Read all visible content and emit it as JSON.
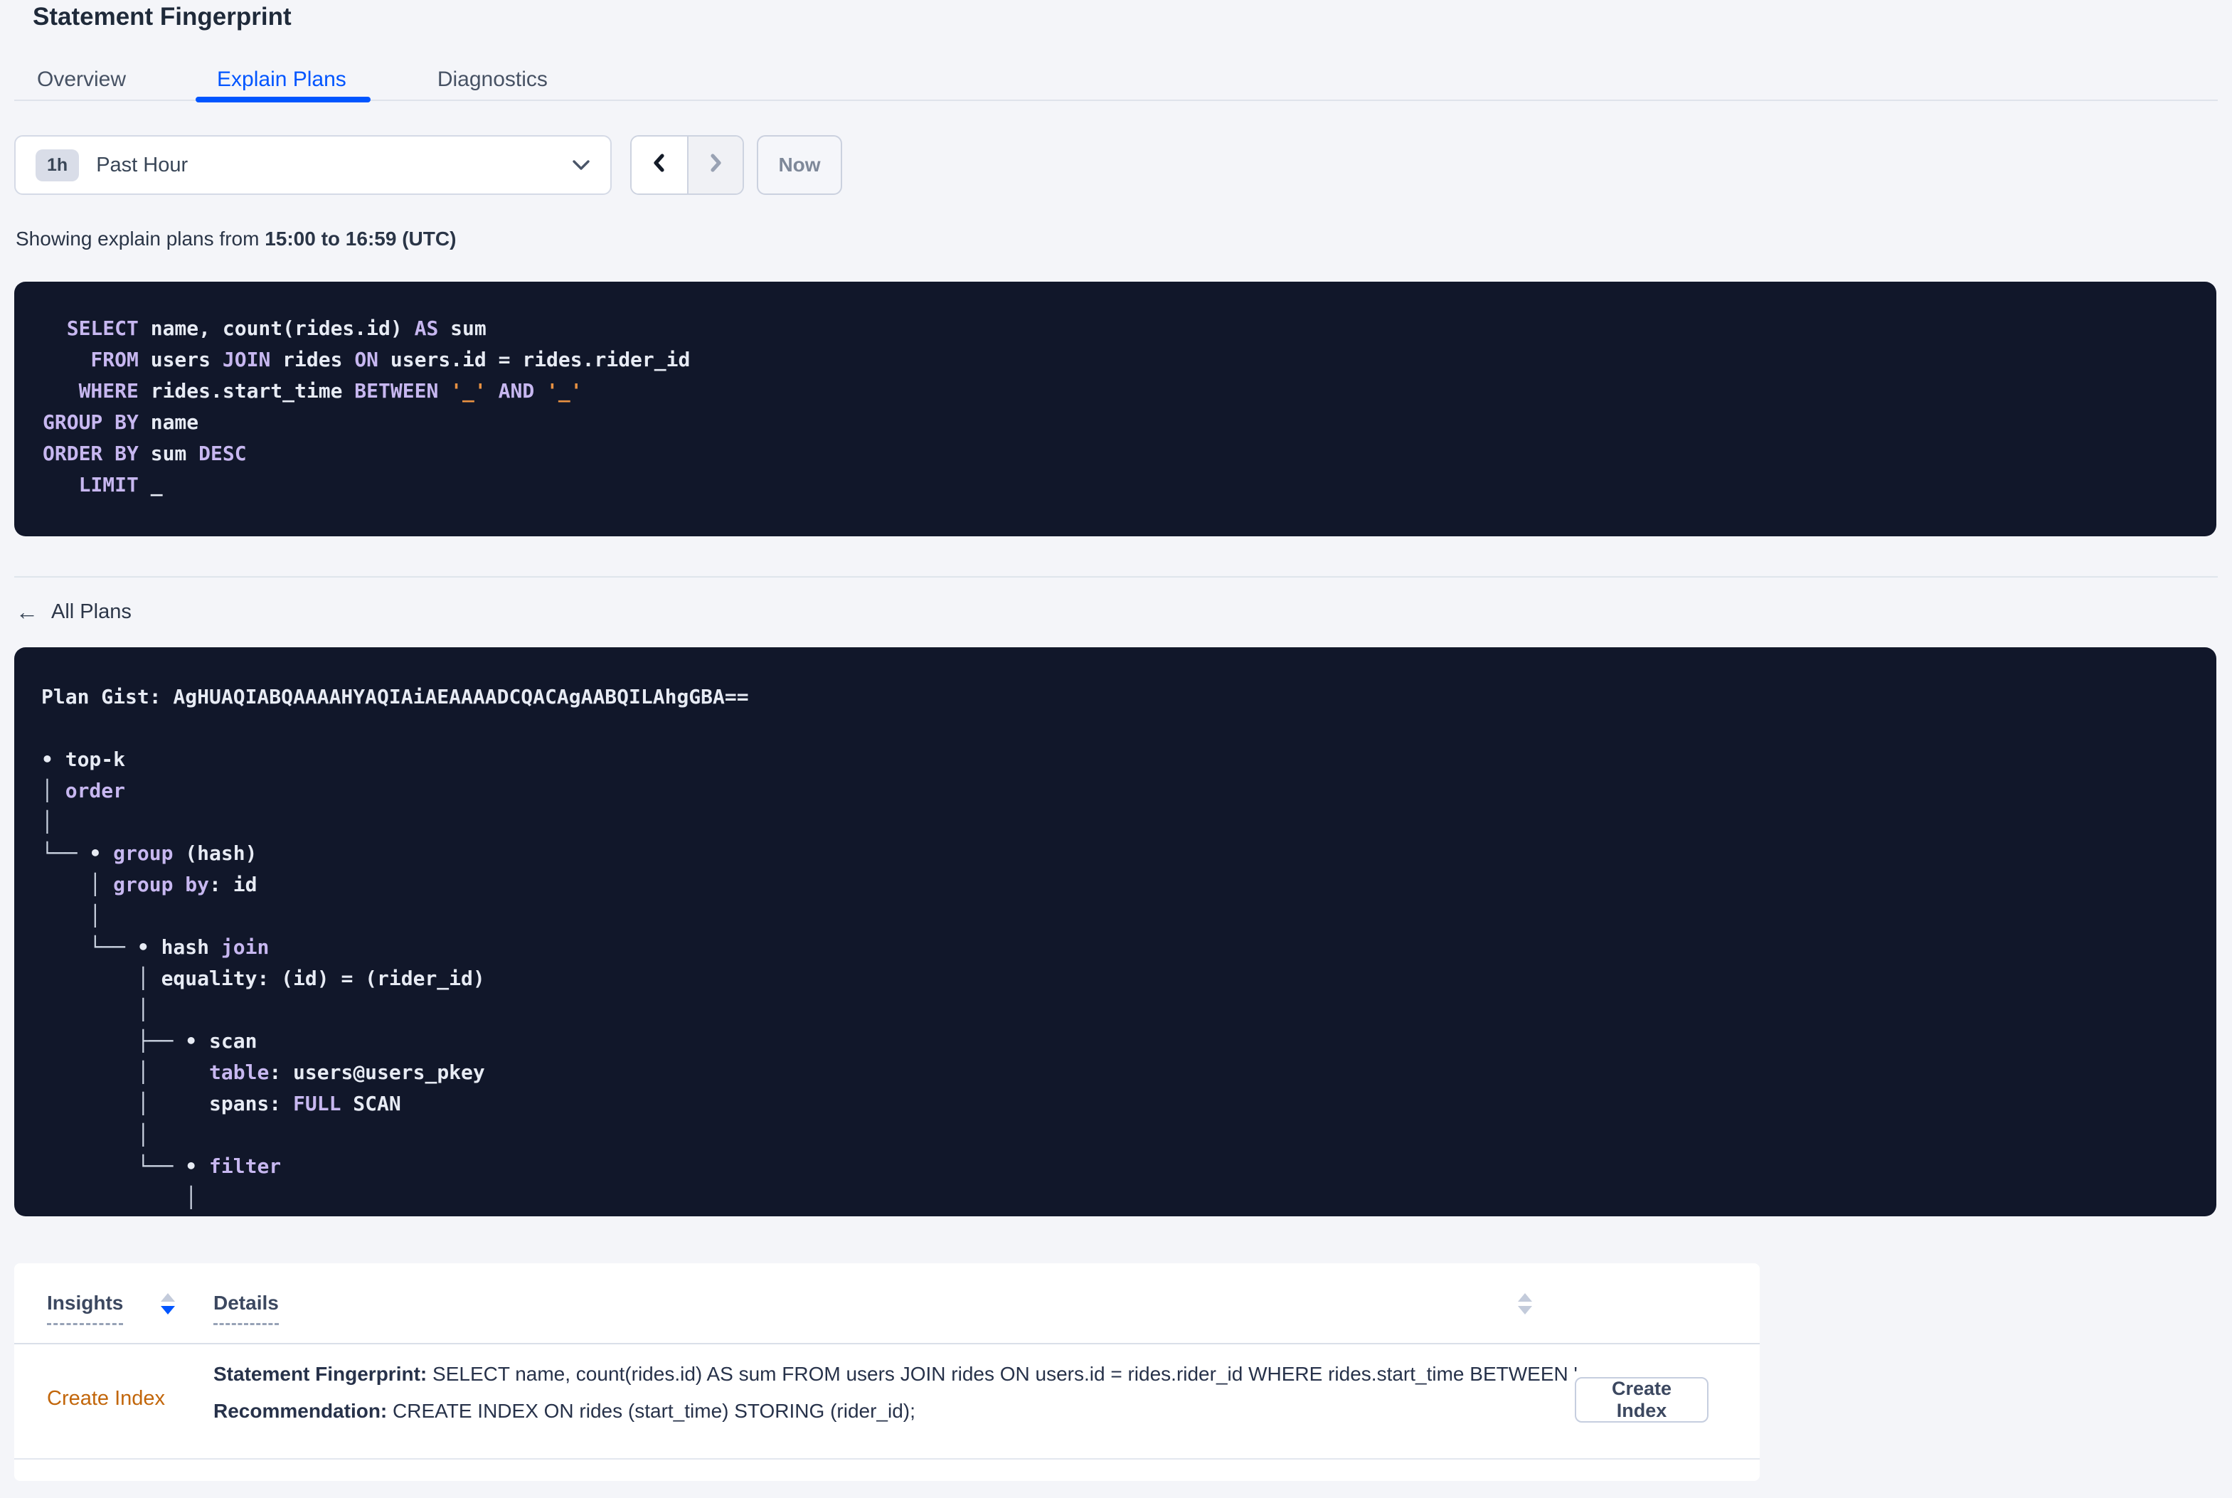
{
  "page": {
    "title": "Statement Fingerprint"
  },
  "tabs": {
    "overview": "Overview",
    "explain_plans": "Explain Plans",
    "diagnostics": "Diagnostics"
  },
  "time_picker": {
    "badge": "1h",
    "selected": "Past Hour",
    "now_button": "Now"
  },
  "caption": {
    "prefix": "Showing explain plans from ",
    "range": "15:00 to 16:59 (UTC)"
  },
  "sql_block": {
    "lines": [
      [
        [
          "p",
          "  SELECT"
        ],
        [
          "w",
          " name, count(rides.id) "
        ],
        [
          "p",
          "AS"
        ],
        [
          "w",
          " sum"
        ]
      ],
      [
        [
          "p",
          "    FROM"
        ],
        [
          "w",
          " users "
        ],
        [
          "p",
          "JOIN"
        ],
        [
          "w",
          " rides "
        ],
        [
          "p",
          "ON"
        ],
        [
          "w",
          " users.id = rides.rider_id"
        ]
      ],
      [
        [
          "p",
          "   WHERE"
        ],
        [
          "w",
          " rides.start_time "
        ],
        [
          "p",
          "BETWEEN"
        ],
        [
          "w",
          " "
        ],
        [
          "o",
          "'_'"
        ],
        [
          "w",
          " "
        ],
        [
          "p",
          "AND"
        ],
        [
          "w",
          " "
        ],
        [
          "o",
          "'_'"
        ]
      ],
      [
        [
          "p",
          "GROUP BY"
        ],
        [
          "w",
          " name"
        ]
      ],
      [
        [
          "p",
          "ORDER BY"
        ],
        [
          "w",
          " sum "
        ],
        [
          "p",
          "DESC"
        ]
      ],
      [
        [
          "p",
          "   LIMIT"
        ],
        [
          "w",
          " _"
        ]
      ]
    ]
  },
  "all_plans": {
    "icon": "←",
    "label": "All Plans"
  },
  "plan_gist": {
    "header": "Plan Gist: AgHUAQIABQAAAAHYAQIAiAEAAAADCQACAgAABQILAhgGBA==",
    "tree_lines": [
      [
        [
          "w",
          "• top-k"
        ]
      ],
      [
        [
          "d",
          "│ "
        ],
        [
          "p",
          "order"
        ]
      ],
      [
        [
          "d",
          "│"
        ]
      ],
      [
        [
          "d",
          "└── "
        ],
        [
          "w",
          "• "
        ],
        [
          "p",
          "group"
        ],
        [
          "w",
          " (hash)"
        ]
      ],
      [
        [
          "d",
          "    │ "
        ],
        [
          "p",
          "group by"
        ],
        [
          "w",
          ": id"
        ]
      ],
      [
        [
          "d",
          "    │"
        ]
      ],
      [
        [
          "d",
          "    └── "
        ],
        [
          "w",
          "• hash "
        ],
        [
          "p",
          "join"
        ]
      ],
      [
        [
          "d",
          "        │ "
        ],
        [
          "w",
          "equality: (id) = (rider_id)"
        ]
      ],
      [
        [
          "d",
          "        │"
        ]
      ],
      [
        [
          "d",
          "        ├── "
        ],
        [
          "w",
          "• scan"
        ]
      ],
      [
        [
          "d",
          "        │"
        ],
        [
          "w",
          "     "
        ],
        [
          "p",
          "table"
        ],
        [
          "w",
          ": users@users_pkey"
        ]
      ],
      [
        [
          "d",
          "        │"
        ],
        [
          "w",
          "     spans: "
        ],
        [
          "p",
          "FULL"
        ],
        [
          "w",
          " SCAN"
        ]
      ],
      [
        [
          "d",
          "        │"
        ]
      ],
      [
        [
          "d",
          "        └── "
        ],
        [
          "w",
          "• "
        ],
        [
          "p",
          "filter"
        ]
      ],
      [
        [
          "d",
          "            │"
        ]
      ]
    ]
  },
  "insights": {
    "columns": {
      "insights": "Insights",
      "details": "Details"
    },
    "row": {
      "type": "Create Index",
      "fingerprint_label": "Statement Fingerprint:",
      "fingerprint_value": " SELECT name, count(rides.id) AS sum FROM users JOIN rides ON users.id = rides.rider_id WHERE rides.start_time BETWEEN '_…",
      "recommendation_label": "Recommendation:",
      "recommendation_value": " CREATE INDEX ON rides (start_time) STORING (rider_id);",
      "action": "Create Index"
    }
  },
  "colors": {
    "accent_blue": "#0055ff",
    "insight_orange": "#c2660a",
    "code_bg": "#11172a",
    "code_keyword": "#c7b7f0",
    "code_text": "#e7ebf4",
    "code_placeholder": "#e89142"
  }
}
